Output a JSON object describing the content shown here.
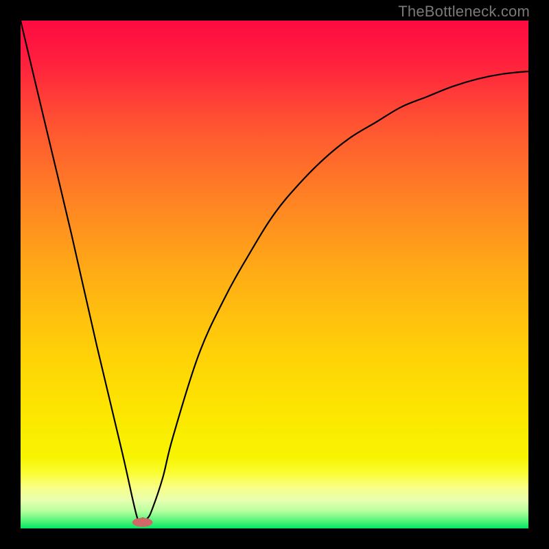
{
  "watermark": "TheBottleneck.com",
  "chart_data": {
    "type": "line",
    "title": "",
    "xlabel": "",
    "ylabel": "",
    "xlim": [
      0,
      100
    ],
    "ylim": [
      0,
      100
    ],
    "grid": false,
    "legend": false,
    "series": [
      {
        "name": "curve",
        "color": "#000000",
        "x": [
          0,
          5,
          10,
          15,
          20,
          23,
          24,
          25,
          26,
          28,
          30,
          35,
          40,
          45,
          50,
          55,
          60,
          65,
          70,
          75,
          80,
          85,
          90,
          95,
          100
        ],
        "values": [
          100,
          79,
          58,
          36,
          15,
          2,
          2,
          2,
          4,
          10,
          18,
          34,
          45,
          54,
          62,
          68,
          73,
          77,
          80,
          83,
          85,
          87,
          88.5,
          89.5,
          90
        ]
      }
    ],
    "marker": {
      "name": "marker",
      "x": 24,
      "y": 1.2,
      "color": "#d06868",
      "rx_percent": 2.0,
      "ry_percent": 0.9
    },
    "background_gradient": {
      "direction": "vertical",
      "stops": [
        {
          "offset": 0.0,
          "color": "#fe0b41"
        },
        {
          "offset": 0.08,
          "color": "#ff1f3e"
        },
        {
          "offset": 0.2,
          "color": "#ff5232"
        },
        {
          "offset": 0.35,
          "color": "#ff8224"
        },
        {
          "offset": 0.5,
          "color": "#ffad15"
        },
        {
          "offset": 0.65,
          "color": "#ffd008"
        },
        {
          "offset": 0.78,
          "color": "#fce800"
        },
        {
          "offset": 0.86,
          "color": "#f7f402"
        },
        {
          "offset": 0.89,
          "color": "#fafd31"
        },
        {
          "offset": 0.92,
          "color": "#f9ff88"
        },
        {
          "offset": 0.945,
          "color": "#e6ffb0"
        },
        {
          "offset": 0.965,
          "color": "#b9ffa0"
        },
        {
          "offset": 0.985,
          "color": "#55f57a"
        },
        {
          "offset": 1.0,
          "color": "#00e765"
        }
      ]
    }
  }
}
